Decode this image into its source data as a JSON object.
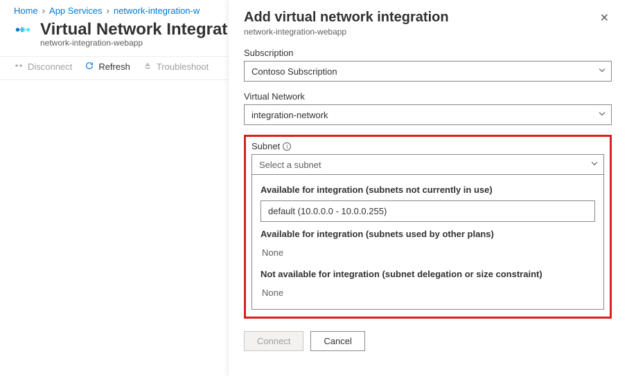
{
  "breadcrumb": {
    "items": [
      "Home",
      "App Services",
      "network-integration-w"
    ]
  },
  "page": {
    "title": "Virtual Network Integrat",
    "subtitle": "network-integration-webapp"
  },
  "toolbar": {
    "disconnect": "Disconnect",
    "refresh": "Refresh",
    "troubleshoot": "Troubleshoot"
  },
  "panel": {
    "title": "Add virtual network integration",
    "subtitle": "network-integration-webapp",
    "subscription": {
      "label": "Subscription",
      "value": "Contoso Subscription"
    },
    "vnet": {
      "label": "Virtual Network",
      "value": "integration-network"
    },
    "subnet": {
      "label": "Subnet",
      "placeholder": "Select a subnet",
      "group1_title": "Available for integration (subnets not currently in use)",
      "group1_option": "default (10.0.0.0 - 10.0.0.255)",
      "group2_title": "Available for integration (subnets used by other plans)",
      "group2_none": "None",
      "group3_title": "Not available for integration (subnet delegation or size constraint)",
      "group3_none": "None"
    },
    "footer": {
      "connect": "Connect",
      "cancel": "Cancel"
    }
  }
}
